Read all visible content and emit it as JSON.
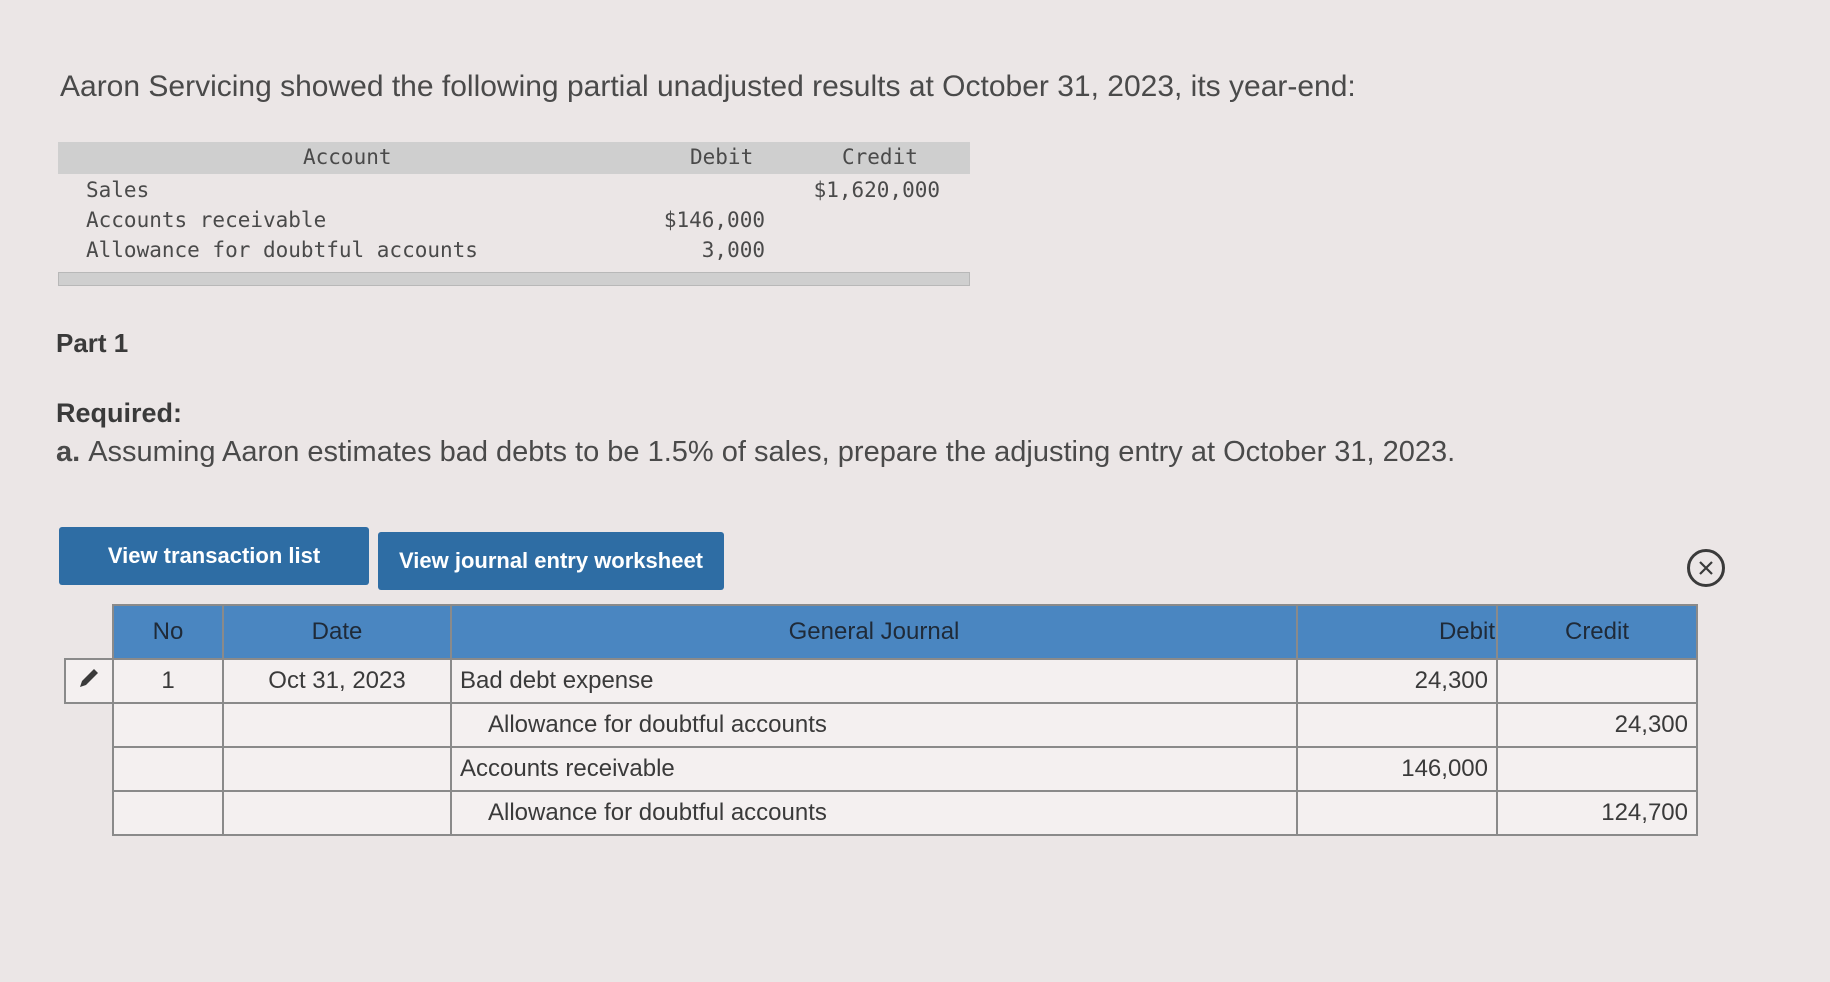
{
  "intro": "Aaron Servicing showed the following partial unadjusted results at October 31, 2023, its year-end:",
  "accounts": {
    "headers": {
      "account": "Account",
      "debit": "Debit",
      "credit": "Credit"
    },
    "rows": [
      {
        "account": "Sales",
        "debit": "",
        "credit": "$1,620,000"
      },
      {
        "account": "Accounts receivable",
        "debit": "$146,000",
        "credit": ""
      },
      {
        "account": "Allowance for doubtful accounts",
        "debit": "3,000",
        "credit": ""
      }
    ]
  },
  "part": "Part 1",
  "required": {
    "label": "Required:",
    "letter": "a.",
    "text": "Assuming Aaron estimates bad debts to be 1.5% of sales, prepare the adjusting entry at October 31, 2023."
  },
  "buttons": {
    "transactions": "View transaction list",
    "worksheet": "View journal entry worksheet"
  },
  "journal": {
    "headers": {
      "no": "No",
      "date": "Date",
      "general": "General Journal",
      "debit": "Debit",
      "credit": "Credit"
    },
    "rows": [
      {
        "no": "1",
        "date": "Oct 31, 2023",
        "account": "Bad debt expense",
        "debit": "24,300",
        "credit": ""
      },
      {
        "no": "",
        "date": "",
        "account": "Allowance for doubtful accounts",
        "debit": "",
        "credit": "24,300"
      },
      {
        "no": "",
        "date": "",
        "account": "Accounts receivable",
        "debit": "146,000",
        "credit": ""
      },
      {
        "no": "",
        "date": "",
        "account": "Allowance for doubtful accounts",
        "debit": "",
        "credit": "124,700"
      }
    ]
  },
  "icons": {
    "edit": "pencil-icon",
    "close": "close-circle-icon"
  }
}
